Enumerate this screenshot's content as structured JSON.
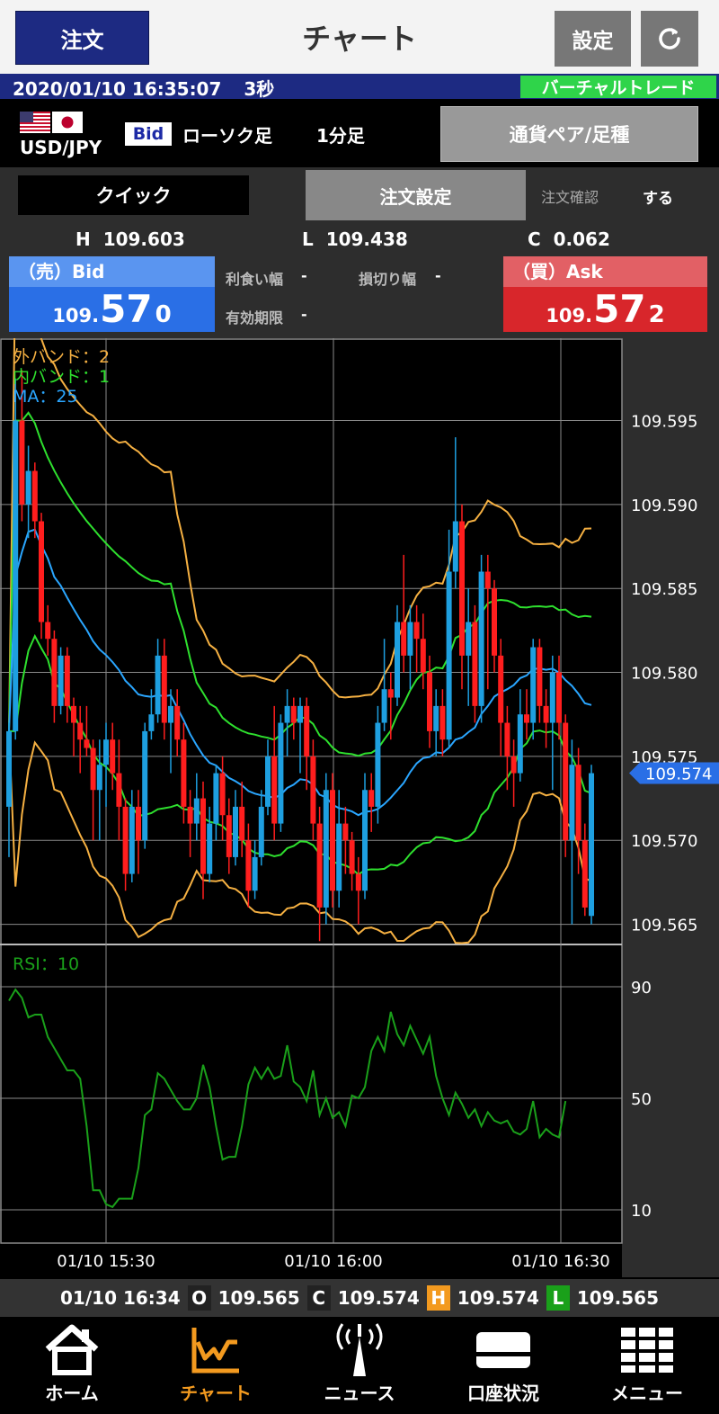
{
  "header": {
    "order_label": "注文",
    "title": "チャート",
    "settings_label": "設定"
  },
  "status": {
    "datetime": "2020/01/10 16:35:07",
    "interval": "3秒",
    "mode": "バーチャルトレード"
  },
  "pair": {
    "symbol": "USD/JPY",
    "price_side": "Bid",
    "candle_type": "ローソク足",
    "timeframe": "1分足",
    "select_label": "通貨ペア/足種"
  },
  "order_panel": {
    "quick_label": "クイック",
    "settings_label": "注文設定",
    "confirm_label": "注文確認",
    "confirm_value": "する",
    "high_label": "H",
    "high": "109.603",
    "low_label": "L",
    "low": "109.438",
    "change_label": "C",
    "change": "0.062",
    "bid": {
      "label": "（売）Bid",
      "prefix": "109.",
      "main": "57",
      "last": "0"
    },
    "ask": {
      "label": "（買）Ask",
      "prefix": "109.",
      "main": "57",
      "last": "2"
    },
    "take_profit_label": "利食い幅",
    "take_profit_value": "-",
    "stop_loss_label": "損切り幅",
    "stop_loss_value": "-",
    "expiry_label": "有効期限",
    "expiry_value": "-"
  },
  "colors": {
    "bull": "#1e9fe0",
    "bear": "#ff1e1e",
    "outer_band": "#f5b042",
    "inner_band": "#2ee02e",
    "ma": "#2aa6ff",
    "rsi": "#1aa01a",
    "grid": "#8a8a8a"
  },
  "chart_data": {
    "type": "candlestick",
    "legend": [
      {
        "label": "外バンド：2",
        "color": "#f5b042"
      },
      {
        "label": "内バンド：1",
        "color": "#2ee02e"
      },
      {
        "label": "MA：25",
        "color": "#2aa6ff"
      }
    ],
    "y_ticks": [
      "109.595",
      "109.590",
      "109.585",
      "109.580",
      "109.575",
      "109.570",
      "109.565"
    ],
    "y_range": [
      109.5638,
      109.5999
    ],
    "current_price": "109.574",
    "x_ticks": [
      "01/10 15:30",
      "01/10 16:00",
      "01/10 16:30"
    ],
    "rsi": {
      "label": "RSI：10",
      "ticks": [
        "90",
        "50",
        "10"
      ],
      "range": [
        0,
        100
      ],
      "values": [
        85,
        89,
        86,
        79,
        80,
        80,
        72,
        68,
        64,
        60,
        60,
        57,
        40,
        17,
        17,
        12,
        11,
        14,
        14,
        14,
        25,
        44,
        46,
        59,
        57,
        53,
        49,
        46,
        46,
        50,
        62,
        54,
        40,
        28,
        29,
        29,
        40,
        55,
        61,
        57,
        61,
        57,
        58,
        69,
        56,
        54,
        49,
        60,
        44,
        50,
        43,
        45,
        40,
        51,
        50,
        54,
        67,
        72,
        67,
        81,
        73,
        69,
        76,
        71,
        66,
        72,
        58,
        50,
        44,
        52,
        48,
        43,
        46,
        40,
        45,
        42,
        41,
        42,
        38,
        37,
        39,
        49,
        36,
        39,
        37,
        36,
        49
      ]
    },
    "x_range_candles": 91,
    "candles": [
      [
        109.572,
        109.577,
        109.569,
        109.5765
      ],
      [
        109.5765,
        109.5975,
        109.576,
        109.595
      ],
      [
        109.595,
        109.598,
        109.589,
        109.59
      ],
      [
        109.59,
        109.5935,
        109.588,
        109.592
      ],
      [
        109.592,
        109.5925,
        109.588,
        109.589
      ],
      [
        109.589,
        109.5895,
        109.582,
        109.583
      ],
      [
        109.583,
        109.584,
        109.581,
        109.582
      ],
      [
        109.582,
        109.5825,
        109.577,
        109.578
      ],
      [
        109.578,
        109.5815,
        109.5775,
        109.581
      ],
      [
        109.581,
        109.5815,
        109.577,
        109.578
      ],
      [
        109.578,
        109.5785,
        109.575,
        109.577
      ],
      [
        109.577,
        109.578,
        109.574,
        109.576
      ],
      [
        109.576,
        109.578,
        109.575,
        109.5755
      ],
      [
        109.5755,
        109.576,
        109.57,
        109.573
      ],
      [
        109.573,
        109.576,
        109.57,
        109.5745
      ],
      [
        109.5745,
        109.577,
        109.572,
        109.576
      ],
      [
        109.576,
        109.577,
        109.573,
        109.574
      ],
      [
        109.574,
        109.576,
        109.57,
        109.572
      ],
      [
        109.572,
        109.5725,
        109.567,
        109.568
      ],
      [
        109.568,
        109.573,
        109.5675,
        109.572
      ],
      [
        109.572,
        109.573,
        109.568,
        109.57
      ],
      [
        109.57,
        109.577,
        109.5695,
        109.5765
      ],
      [
        109.5765,
        109.579,
        109.576,
        109.5775
      ],
      [
        109.5775,
        109.582,
        109.577,
        109.581
      ],
      [
        109.581,
        109.582,
        109.576,
        109.577
      ],
      [
        109.577,
        109.579,
        109.574,
        109.578
      ],
      [
        109.578,
        109.579,
        109.575,
        109.576
      ],
      [
        109.576,
        109.577,
        109.571,
        109.572
      ],
      [
        109.572,
        109.573,
        109.569,
        109.571
      ],
      [
        109.571,
        109.574,
        109.57,
        109.5725
      ],
      [
        109.5725,
        109.5735,
        109.5665,
        109.568
      ],
      [
        109.568,
        109.572,
        109.5675,
        109.571
      ],
      [
        109.571,
        109.5745,
        109.57,
        109.574
      ],
      [
        109.574,
        109.575,
        109.57,
        109.5715
      ],
      [
        109.5715,
        109.5725,
        109.568,
        109.569
      ],
      [
        109.569,
        109.573,
        109.5685,
        109.572
      ],
      [
        109.572,
        109.5735,
        109.569,
        109.57
      ],
      [
        109.57,
        109.571,
        109.566,
        109.567
      ],
      [
        109.567,
        109.57,
        109.5665,
        109.569
      ],
      [
        109.569,
        109.573,
        109.5685,
        109.572
      ],
      [
        109.572,
        109.576,
        109.5715,
        109.575
      ],
      [
        109.575,
        109.578,
        109.57,
        109.571
      ],
      [
        109.571,
        109.5775,
        109.5705,
        109.577
      ],
      [
        109.577,
        109.579,
        109.575,
        109.578
      ],
      [
        109.578,
        109.5785,
        109.576,
        109.577
      ],
      [
        109.577,
        109.5785,
        109.574,
        109.578
      ],
      [
        109.578,
        109.5785,
        109.573,
        109.575
      ],
      [
        109.575,
        109.576,
        109.57,
        109.571
      ],
      [
        109.571,
        109.572,
        109.564,
        109.566
      ],
      [
        109.566,
        109.574,
        109.565,
        109.573
      ],
      [
        109.573,
        109.574,
        109.566,
        109.567
      ],
      [
        109.567,
        109.573,
        109.566,
        109.571
      ],
      [
        109.571,
        109.572,
        109.568,
        109.57
      ],
      [
        109.57,
        109.5705,
        109.567,
        109.568
      ],
      [
        109.568,
        109.569,
        109.565,
        109.567
      ],
      [
        109.567,
        109.574,
        109.5665,
        109.573
      ],
      [
        109.573,
        109.574,
        109.5705,
        109.572
      ],
      [
        109.572,
        109.578,
        109.571,
        109.577
      ],
      [
        109.577,
        109.582,
        109.5765,
        109.579
      ],
      [
        109.579,
        109.58,
        109.576,
        109.5785
      ],
      [
        109.5785,
        109.584,
        109.578,
        109.583
      ],
      [
        109.583,
        109.587,
        109.58,
        109.581
      ],
      [
        109.581,
        109.584,
        109.579,
        109.583
      ],
      [
        109.583,
        109.584,
        109.58,
        109.582
      ],
      [
        109.582,
        109.5835,
        109.579,
        109.58
      ],
      [
        109.58,
        109.581,
        109.5755,
        109.5765
      ],
      [
        109.5765,
        109.579,
        109.575,
        109.578
      ],
      [
        109.578,
        109.579,
        109.575,
        109.576
      ],
      [
        109.576,
        109.5885,
        109.5755,
        109.586
      ],
      [
        109.586,
        109.594,
        109.585,
        109.589
      ],
      [
        109.589,
        109.59,
        109.579,
        109.581
      ],
      [
        109.581,
        109.585,
        109.578,
        109.583
      ],
      [
        109.583,
        109.584,
        109.577,
        109.578
      ],
      [
        109.578,
        109.587,
        109.577,
        109.586
      ],
      [
        109.586,
        109.587,
        109.579,
        109.585
      ],
      [
        109.585,
        109.5855,
        109.58,
        109.581
      ],
      [
        109.581,
        109.582,
        109.575,
        109.577
      ],
      [
        109.577,
        109.578,
        109.573,
        109.575
      ],
      [
        109.575,
        109.576,
        109.572,
        109.574
      ],
      [
        109.574,
        109.579,
        109.5735,
        109.5775
      ],
      [
        109.5775,
        109.579,
        109.576,
        109.577
      ],
      [
        109.577,
        109.582,
        109.576,
        109.5815
      ],
      [
        109.5815,
        109.582,
        109.577,
        109.578
      ],
      [
        109.578,
        109.579,
        109.5755,
        109.577
      ],
      [
        109.577,
        109.581,
        109.573,
        109.58
      ],
      [
        109.58,
        109.581,
        109.576,
        109.577
      ],
      [
        109.577,
        109.5775,
        109.569,
        109.57
      ],
      [
        109.57,
        109.576,
        109.565,
        109.5745
      ],
      [
        109.5745,
        109.5755,
        109.568,
        109.57
      ],
      [
        109.57,
        109.571,
        109.5655,
        109.566
      ],
      [
        109.5655,
        109.5745,
        109.565,
        109.574
      ]
    ]
  },
  "ohlc_bar": {
    "time": "01/10 16:34",
    "o_label": "O",
    "open": "109.565",
    "c_label": "C",
    "close": "109.574",
    "h_label": "H",
    "high": "109.574",
    "l_label": "L",
    "low": "109.565"
  },
  "nav": {
    "items": [
      {
        "label": "ホーム",
        "icon": "home-icon"
      },
      {
        "label": "チャート",
        "icon": "chart-icon"
      },
      {
        "label": "ニュース",
        "icon": "news-icon"
      },
      {
        "label": "口座状況",
        "icon": "account-icon"
      },
      {
        "label": "メニュー",
        "icon": "menu-icon"
      }
    ]
  }
}
